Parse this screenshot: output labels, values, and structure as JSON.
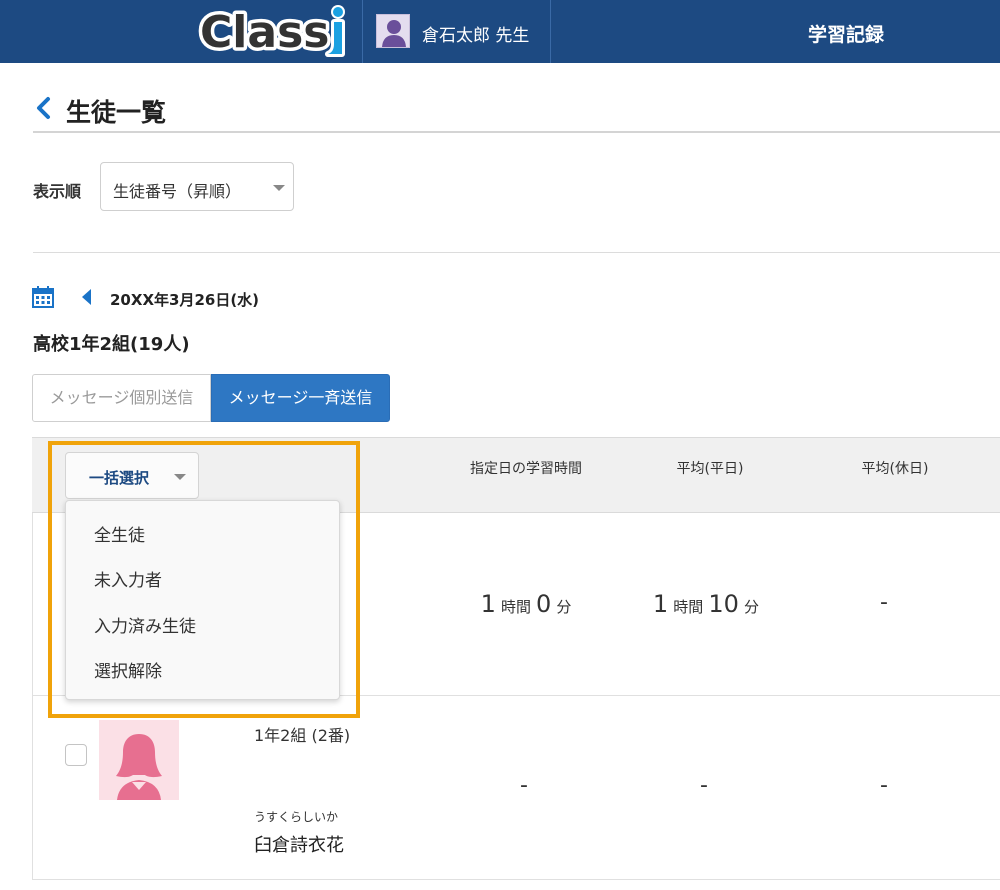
{
  "header": {
    "logo_text": "Classi",
    "user_name": "倉石太郎 先生",
    "app_title": "学習記録",
    "colors": {
      "background": "#1d4a82",
      "logo_accent": "#1ba1e2"
    }
  },
  "page": {
    "title": "生徒一覧",
    "back_icon": "chevron-left-icon"
  },
  "sort": {
    "label": "表示順",
    "selected": "生徒番号（昇順）"
  },
  "date_nav": {
    "calendar_icon": "calendar-icon",
    "prev_icon": "triangle-left-icon",
    "date": "20XX年3月26日(水)"
  },
  "class_info": "高校1年2組(19人)",
  "message_buttons": {
    "individual": "メッセージ個別送信",
    "bulk": "メッセージ一斉送信",
    "bulk_color": "#2e77c3"
  },
  "table": {
    "headers": {
      "study_time": "指定日の学習時間",
      "avg_weekday": "平均(平日)",
      "avg_holiday": "平均(休日)"
    },
    "rows": [
      {
        "study_time": {
          "hours": "1",
          "hours_unit": "時間",
          "minutes": "0",
          "minutes_unit": "分"
        },
        "avg_weekday": {
          "hours": "1",
          "hours_unit": "時間",
          "minutes": "10",
          "minutes_unit": "分"
        },
        "avg_holiday": "-"
      },
      {
        "class_number": "1年2組 (2番)",
        "kana": "うすくらしいか",
        "name": "臼倉詩衣花",
        "study_time": "-",
        "avg_weekday": "-",
        "avg_holiday": "-",
        "photo_bg": "#fbe0e6",
        "photo_fg": "#e76f90"
      }
    ]
  },
  "bulk_select": {
    "label": "一括選択",
    "menu_items": [
      "全生徒",
      "未入力者",
      "入力済み生徒",
      "選択解除"
    ],
    "highlight_color": "#f0a30a"
  }
}
